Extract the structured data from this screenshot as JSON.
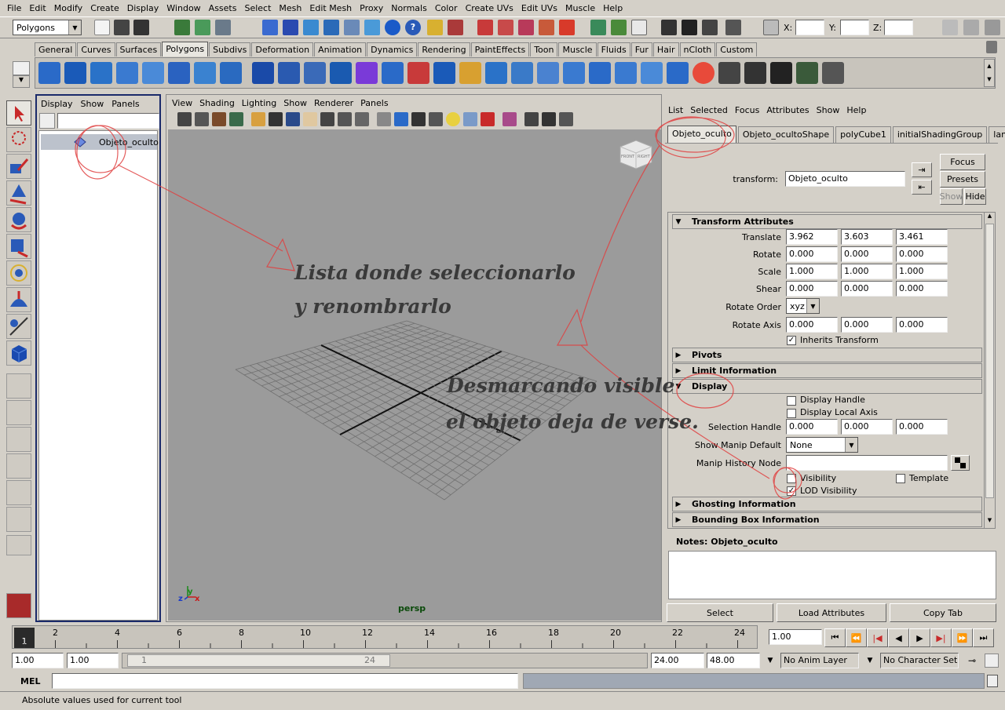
{
  "menu": [
    "File",
    "Edit",
    "Modify",
    "Create",
    "Display",
    "Window",
    "Assets",
    "Select",
    "Mesh",
    "Edit Mesh",
    "Proxy",
    "Normals",
    "Color",
    "Create UVs",
    "Edit UVs",
    "Muscle",
    "Help"
  ],
  "status_line": {
    "menu_set": "Polygons",
    "x_label": "X:",
    "y_label": "Y:",
    "z_label": "Z:"
  },
  "shelf_tabs": [
    "General",
    "Curves",
    "Surfaces",
    "Polygons",
    "Subdivs",
    "Deformation",
    "Animation",
    "Dynamics",
    "Rendering",
    "PaintEffects",
    "Toon",
    "Muscle",
    "Fluids",
    "Fur",
    "Hair",
    "nCloth",
    "Custom"
  ],
  "active_shelf_tab": "Polygons",
  "outliner": {
    "menu": [
      "Display",
      "Show",
      "Panels"
    ],
    "items": [
      "Objeto_oculto"
    ]
  },
  "viewport": {
    "menu": [
      "View",
      "Shading",
      "Lighting",
      "Show",
      "Renderer",
      "Panels"
    ],
    "camera": "persp",
    "axis_x": "x",
    "axis_y": "y",
    "axis_z": "z",
    "cube_front": "FRONT",
    "cube_right": "RIGHT"
  },
  "attribute_editor": {
    "menu": [
      "List",
      "Selected",
      "Focus",
      "Attributes",
      "Show",
      "Help"
    ],
    "tabs": [
      "Objeto_oculto",
      "Objeto_ocultoShape",
      "polyCube1",
      "initialShadingGroup",
      "lambert1"
    ],
    "node_type_label": "transform:",
    "node_name": "Objeto_oculto",
    "buttons": {
      "focus": "Focus",
      "presets": "Presets",
      "show": "Show",
      "hide": "Hide"
    },
    "transform": {
      "title": "Transform Attributes",
      "translate_label": "Translate",
      "translate": [
        "3.962",
        "3.603",
        "3.461"
      ],
      "rotate_label": "Rotate",
      "rotate": [
        "0.000",
        "0.000",
        "0.000"
      ],
      "scale_label": "Scale",
      "scale": [
        "1.000",
        "1.000",
        "1.000"
      ],
      "shear_label": "Shear",
      "shear": [
        "0.000",
        "0.000",
        "0.000"
      ],
      "rotate_order_label": "Rotate Order",
      "rotate_order": "xyz",
      "rotate_axis_label": "Rotate Axis",
      "rotate_axis": [
        "0.000",
        "0.000",
        "0.000"
      ],
      "inherits_label": "Inherits Transform"
    },
    "pivots_title": "Pivots",
    "limit_title": "Limit Information",
    "display": {
      "title": "Display",
      "display_handle": "Display Handle",
      "display_local_axis": "Display Local Axis",
      "selection_handle_label": "Selection Handle",
      "selection_handle": [
        "0.000",
        "0.000",
        "0.000"
      ],
      "show_manip_label": "Show Manip Default",
      "show_manip": "None",
      "manip_history_label": "Manip History Node",
      "visibility": "Visibility",
      "template": "Template",
      "lod_visibility": "LOD Visibility"
    },
    "ghosting_title": "Ghosting Information",
    "bbox_title": "Bounding Box Information",
    "notes_label": "Notes:  Objeto_oculto",
    "bottom_buttons": [
      "Select",
      "Load Attributes",
      "Copy Tab"
    ]
  },
  "time_slider": {
    "ticks": [
      "1",
      "2",
      "4",
      "6",
      "8",
      "10",
      "12",
      "14",
      "16",
      "18",
      "20",
      "22",
      "24"
    ],
    "current": "1.00"
  },
  "range": {
    "start": "1.00",
    "playback_start": "1.00",
    "range_start_label": "1",
    "range_end_label": "24",
    "playback_end": "24.00",
    "end": "48.00",
    "anim_layer": "No Anim Layer",
    "character_set": "No Character Set"
  },
  "command_line": {
    "label": "MEL"
  },
  "help_line": "Absolute values used for current tool",
  "annotations": {
    "note1_line1": "Lista donde seleccionarlo",
    "note1_line2": "y renombrarlo",
    "note2_line1": "Desmarcando visible",
    "note2_line2": "el objeto deja de verse."
  }
}
